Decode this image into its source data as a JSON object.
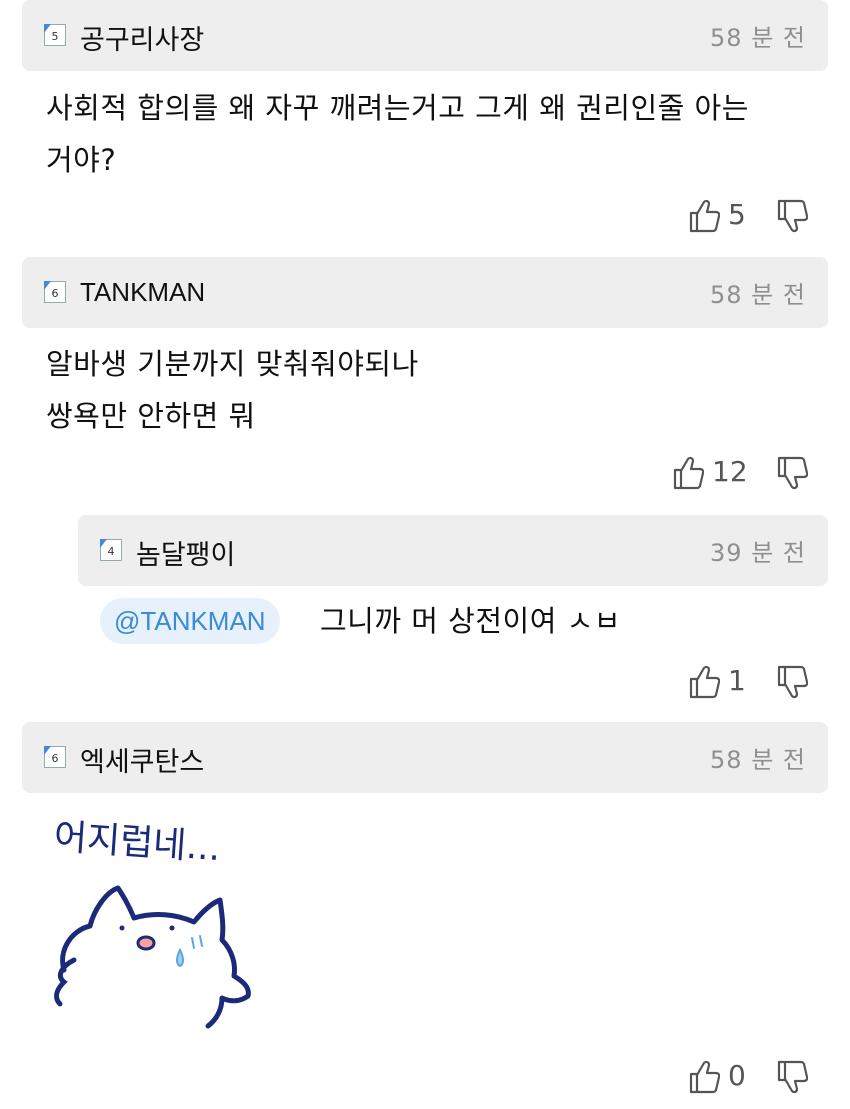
{
  "comments": [
    {
      "username": "공구리사장",
      "level": "5",
      "time": "58 분 전",
      "text": "사회적 합의를 왜 자꾸 깨려는거고 그게 왜 권리인줄 아는\n거야?",
      "likes": "5"
    },
    {
      "username": "TANKMAN",
      "level": "6",
      "time": "58 분 전",
      "text": "알바생 기분까지 맞춰줘야되나\n쌍욕만 안하면 뭐",
      "likes": "12"
    },
    {
      "username": "놈달팽이",
      "level": "4",
      "time": "39 분 전",
      "mention": "@TANKMAN",
      "text": "그니까 머 상전이여 ㅅㅂ",
      "likes": "1",
      "is_reply": true
    },
    {
      "username": "엑세쿠탄스",
      "level": "6",
      "time": "58 분 전",
      "sticker_text": "어지럽네...",
      "likes": "0"
    }
  ],
  "colors": {
    "header_bg": "#eeeeee",
    "mention_bg": "#e7f1fb",
    "mention_text": "#3a8ad9",
    "sticker_ink": "#1c2a7a"
  },
  "icons": [
    "level-badge-icon",
    "thumbs-up-icon",
    "thumbs-down-icon"
  ]
}
